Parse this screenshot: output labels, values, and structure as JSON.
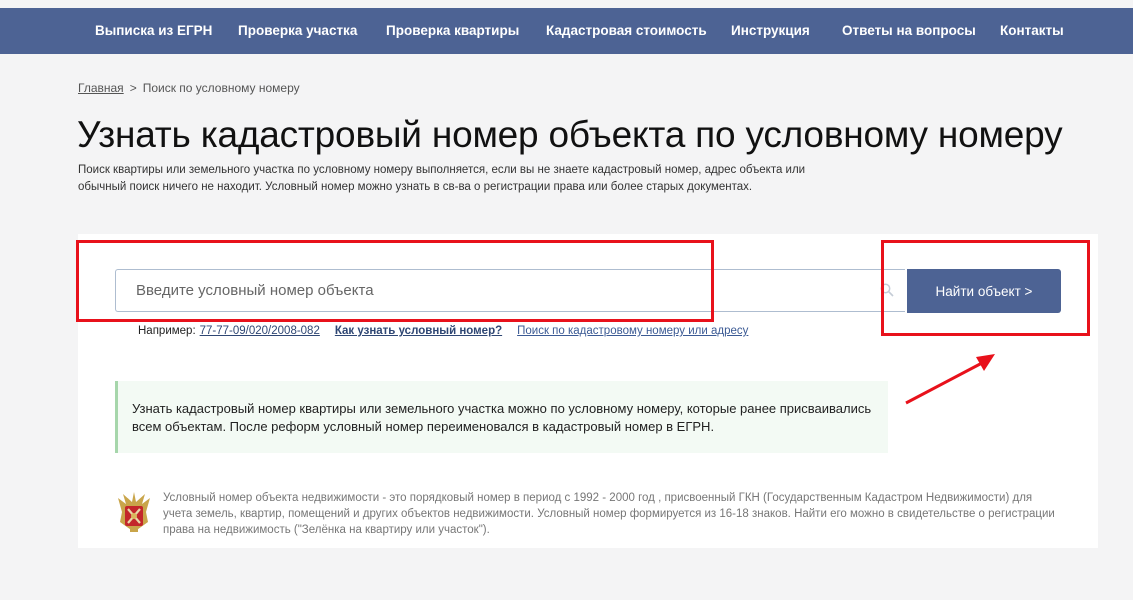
{
  "nav": {
    "items": [
      {
        "label": "Выписка из ЕГРН"
      },
      {
        "label": "Проверка участка"
      },
      {
        "label": "Проверка квартиры"
      },
      {
        "label": "Кадастровая стоимость"
      },
      {
        "label": "Инструкция"
      },
      {
        "label": "Ответы на вопросы"
      },
      {
        "label": "Контакты"
      }
    ]
  },
  "breadcrumb": {
    "home": "Главная",
    "separator": ">",
    "current": "Поиск по условному номеру"
  },
  "page": {
    "title": "Узнать кадастровый номер объекта по условному номеру",
    "intro": "Поиск квартиры или земельного участка по условному номеру выполняется, если вы не знаете кадастровый номер, адрес объекта или обычный поиск ничего не находит. Условный номер можно узнать в св-ва о регистрации права или более старых документах."
  },
  "search": {
    "placeholder": "Введите условный номер объекта",
    "value": "",
    "button_label": "Найти объект >"
  },
  "examples": {
    "prefix": "Например:",
    "example_number": "77-77-09/020/2008-082",
    "how_link": "Как узнать условный номер?",
    "cadastral_link": "Поиск по кадастровому номеру или адресу"
  },
  "notice": {
    "text": "Узнать кадастровый номер квартиры или земельного участка можно по условному номеру, которые ранее присваивались всем объектам. После реформ условный номер переименовался в кадастровый номер в ЕГРН."
  },
  "footnote": {
    "text": "Условный номер объекта недвижимости - это порядковый номер в период с 1992 - 2000 год , присвоенный ГКН (Государственным Кадастром Недвижимости) для учета земель, квартир, помещений и других объектов недвижимости. Условный номер формируется из 16-18 знаков. Найти его можно в свидетельстве о регистрации права на недвижимость (\"Зелёнка на квартиру или участок\")."
  },
  "colors": {
    "brand": "#4d6394",
    "highlight": "#e8111b",
    "notice_border": "#a6d6ab"
  },
  "icons": [
    "search-icon",
    "emblem-icon"
  ]
}
